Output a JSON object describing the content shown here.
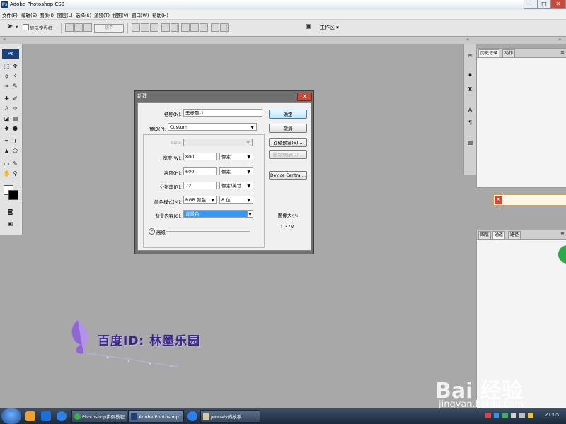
{
  "app": {
    "title": "Adobe Photoshop CS3"
  },
  "menubar": {
    "items": [
      "文件(F)",
      "编辑(E)",
      "图像(I)",
      "图层(L)",
      "选择(S)",
      "滤镜(T)",
      "视图(V)",
      "窗口(W)",
      "帮助(H)"
    ]
  },
  "optionsbar": {
    "show_transform": "显示定界框",
    "combine": "组合",
    "workspace": "工作区 ▾"
  },
  "toolbox": {
    "logo": "Ps"
  },
  "panels": {
    "top_tabs": [
      "历史记录",
      "动作"
    ],
    "bottom_tabs": [
      "图层",
      "通道",
      "路径"
    ]
  },
  "dialog": {
    "title": "新建",
    "name_label": "名称(N):",
    "name_value": "无标题-1",
    "preset_label": "预设(P):",
    "preset_value": "Custom",
    "size_label": "Size:",
    "width_label": "宽度(W):",
    "width_value": "800",
    "width_unit": "像素",
    "height_label": "高度(H):",
    "height_value": "600",
    "height_unit": "像素",
    "resolution_label": "分辨率(R):",
    "resolution_value": "72",
    "resolution_unit": "像素/英寸",
    "color_mode_label": "颜色模式(M):",
    "color_mode_value": "RGB 颜色",
    "bit_depth_value": "8 位",
    "bg_label": "背景内容(C):",
    "bg_value": "背景色",
    "advanced_label": "高级",
    "ok_button": "确定",
    "cancel_button": "取消",
    "save_preset_button": "存储预设(S)...",
    "delete_preset_button": "删除预设(D)...",
    "device_central_button": "Device Central...",
    "image_size_label": "图像大小:",
    "image_size_value": "1.37M"
  },
  "watermark": {
    "text": "百度ID: 林墨乐园"
  },
  "baidu": {
    "logo_text": "Bai 经验",
    "url": "jingyan.baidu.com"
  },
  "taskbar": {
    "tasks": [
      "Photoshop实例教程...",
      "Adobe Photoshop ...",
      "Jennaly的故事"
    ],
    "clock": "21:05"
  },
  "colors": {
    "accent": "#3399ff",
    "canvas": "#a8a8a8",
    "dialog_frame": "#6f6f6f"
  }
}
